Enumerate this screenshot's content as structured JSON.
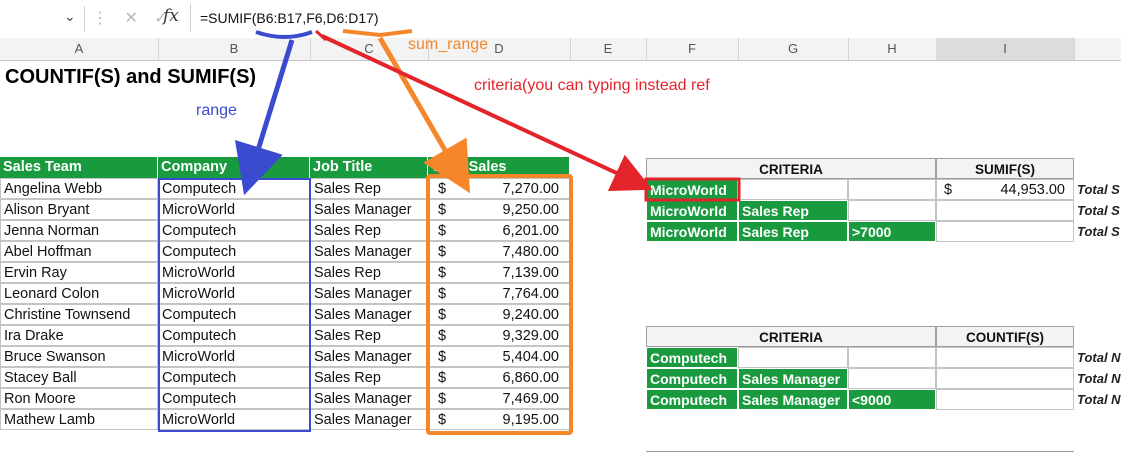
{
  "formula_bar": {
    "name_box_chevron": "⌄",
    "formula": "=SUMIF(B6:B17,F6,D6:D17)",
    "fx_label": "fx"
  },
  "columns": [
    "A",
    "B",
    "C",
    "D",
    "E",
    "F",
    "G",
    "H",
    "I"
  ],
  "selected_column": "I",
  "sheet": {
    "title": "COUNTIF(S) and SUMIF(S)",
    "table_headers": [
      "Sales Team",
      "Company",
      "Job Title",
      "Total Sales"
    ],
    "rows": [
      {
        "team": "Angelina Webb",
        "company": "Computech",
        "job": "Sales Rep",
        "cur": "$",
        "amount": "7,270.00"
      },
      {
        "team": "Alison Bryant",
        "company": "MicroWorld",
        "job": "Sales Manager",
        "cur": "$",
        "amount": "9,250.00"
      },
      {
        "team": "Jenna Norman",
        "company": "Computech",
        "job": "Sales Rep",
        "cur": "$",
        "amount": "6,201.00"
      },
      {
        "team": "Abel Hoffman",
        "company": "Computech",
        "job": "Sales Manager",
        "cur": "$",
        "amount": "7,480.00"
      },
      {
        "team": "Ervin Ray",
        "company": "MicroWorld",
        "job": "Sales Rep",
        "cur": "$",
        "amount": "7,139.00"
      },
      {
        "team": "Leonard Colon",
        "company": "MicroWorld",
        "job": "Sales Manager",
        "cur": "$",
        "amount": "7,764.00"
      },
      {
        "team": "Christine Townsend",
        "company": "Computech",
        "job": "Sales Manager",
        "cur": "$",
        "amount": "9,240.00"
      },
      {
        "team": "Ira Drake",
        "company": "Computech",
        "job": "Sales Rep",
        "cur": "$",
        "amount": "9,329.00"
      },
      {
        "team": "Bruce Swanson",
        "company": "MicroWorld",
        "job": "Sales Manager",
        "cur": "$",
        "amount": "5,404.00"
      },
      {
        "team": "Stacey Ball",
        "company": "Computech",
        "job": "Sales Rep",
        "cur": "$",
        "amount": "6,860.00"
      },
      {
        "team": "Ron Moore",
        "company": "Computech",
        "job": "Sales Manager",
        "cur": "$",
        "amount": "7,469.00"
      },
      {
        "team": "Mathew Lamb",
        "company": "MicroWorld",
        "job": "Sales Manager",
        "cur": "$",
        "amount": "9,195.00"
      }
    ],
    "sumif_block": {
      "criteria_header": "CRITERIA",
      "result_header": "SUMIF(S)",
      "rows": [
        {
          "c1": "MicroWorld",
          "c2": "",
          "c3": "",
          "cur": "$",
          "result": "44,953.00",
          "label": "Total S"
        },
        {
          "c1": "MicroWorld",
          "c2": "Sales Rep",
          "c3": "",
          "cur": "",
          "result": "",
          "label": "Total S"
        },
        {
          "c1": "MicroWorld",
          "c2": "Sales Rep",
          "c3": ">7000",
          "cur": "",
          "result": "",
          "label": "Total S"
        }
      ]
    },
    "countif_block": {
      "criteria_header": "CRITERIA",
      "result_header": "COUNTIF(S)",
      "rows": [
        {
          "c1": "Computech",
          "c2": "",
          "c3": "",
          "label": "Total N"
        },
        {
          "c1": "Computech",
          "c2": "Sales Manager",
          "c3": "",
          "label": "Total N"
        },
        {
          "c1": "Computech",
          "c2": "Sales Manager",
          "c3": "<9000",
          "label": "Total N"
        }
      ]
    }
  },
  "annotations": {
    "range": "range",
    "sum_range": "sum_range",
    "criteria": "criteria(you can typing instead ref"
  },
  "colors": {
    "header_green": "#1a9a3f",
    "range_blue": "#3a4bd0",
    "sum_range_orange": "#f5872a",
    "criteria_red": "#e3242b"
  }
}
